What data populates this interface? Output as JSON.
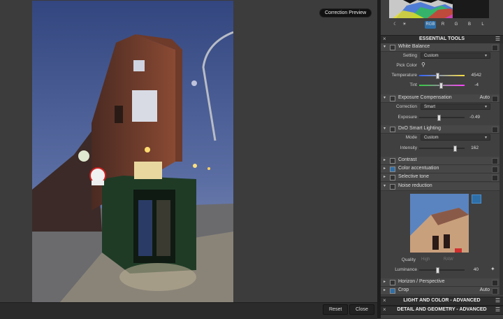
{
  "viewer": {
    "preview_badge": "Correction Preview",
    "reset_label": "Reset",
    "close_label": "Close"
  },
  "histogram": {
    "icon_moon": "☾",
    "icon_sun": "☀",
    "channels": [
      "RGB",
      "R",
      "G",
      "B",
      "L"
    ]
  },
  "essential": {
    "title": "ESSENTIAL TOOLS",
    "white_balance": {
      "name": "White Balance",
      "setting_label": "Setting",
      "setting_value": "Custom",
      "pick_color_label": "Pick Color",
      "temperature_label": "Temperature",
      "temperature_value": "4542",
      "tint_label": "Tint",
      "tint_value": "-4"
    },
    "exposure": {
      "name": "Exposure Compensation",
      "auto": "Auto",
      "correction_label": "Correction",
      "correction_value": "Smart",
      "exposure_label": "Exposure",
      "exposure_value": "-0.49"
    },
    "smart_lighting": {
      "name": "DxO Smart Lighting",
      "mode_label": "Mode",
      "mode_value": "Custom",
      "intensity_label": "Intensity",
      "intensity_value": "162"
    },
    "contrast": {
      "name": "Contrast"
    },
    "color_accentuation": {
      "name": "Color accentuation"
    },
    "selective_tone": {
      "name": "Selective tone"
    },
    "noise": {
      "name": "Noise reduction",
      "quality_label": "Quality",
      "quality_options": [
        "High",
        "RAW"
      ],
      "luminance_label": "Luminance",
      "luminance_value": "40"
    },
    "horizon": {
      "name": "Horizon / Perspective"
    },
    "crop": {
      "name": "Crop",
      "auto": "Auto"
    }
  },
  "sections": {
    "light_color": "LIGHT AND COLOR - ADVANCED",
    "detail_geometry": "DETAIL AND GEOMETRY - ADVANCED"
  },
  "colors": {
    "accent": "#2f6fa8",
    "temp_left": "#3060ff",
    "temp_right": "#ffe040",
    "tint_left": "#30d040",
    "tint_right": "#ff40ff"
  },
  "icons": {
    "close": "×",
    "menu": "☰",
    "collapse": "▾",
    "expand": "▸",
    "dropdown": "▾",
    "pick_color": "⚲"
  }
}
